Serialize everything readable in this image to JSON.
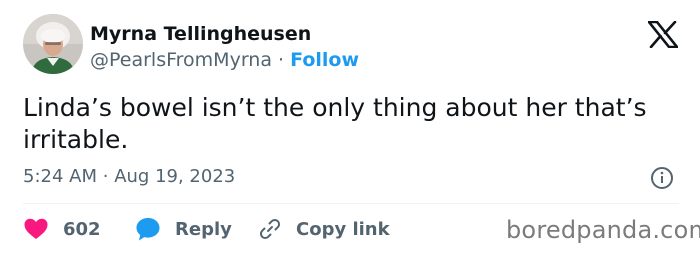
{
  "author": {
    "name": "Myrna Tellingheusen",
    "handle": "@PearlsFromMyrna",
    "separator": "·",
    "follow_label": "Follow"
  },
  "tweet": {
    "text": "Linda’s bowel isn’t the only thing about her that’s irritable.",
    "time": "5:24 AM",
    "separator": "·",
    "date": "Aug 19, 2023"
  },
  "actions": {
    "likes": "602",
    "reply_label": "Reply",
    "copy_label": "Copy link"
  },
  "watermark": "boredpanda.com",
  "icons": {
    "logo": "x-logo-icon",
    "info": "info-icon",
    "like": "heart-icon",
    "reply": "speech-bubble-icon",
    "copy": "link-icon"
  },
  "colors": {
    "text": "#0f1419",
    "secondary": "#536471",
    "follow": "#1d9bf0",
    "heart": "#f91880",
    "reply": "#1d9bf0"
  }
}
